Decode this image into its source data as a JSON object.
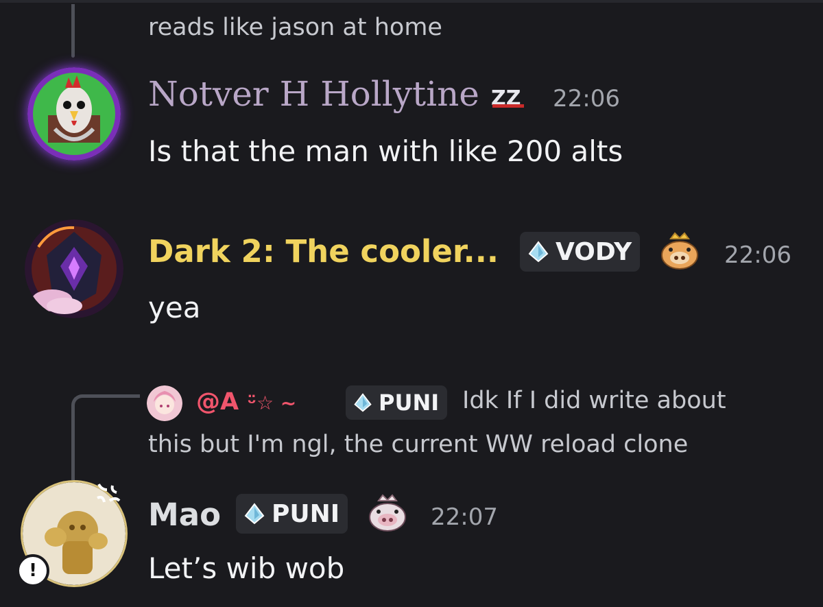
{
  "previous_message": {
    "text": "reads like jason at home"
  },
  "messages": [
    {
      "author": "Notver H Hollytine",
      "author_color": "#b9a7c7",
      "badge_icon": "zz-badge-icon",
      "badge_text": "ZZ",
      "time": "22:06",
      "text": "Is that the man with like 200 alts",
      "avatar": "rooster-avatar"
    },
    {
      "author": "Dark 2: The cooler...",
      "author_color": "#f0d35e",
      "tag": {
        "icon": "water-drop-icon",
        "label": "VODY"
      },
      "badge_icon": "crowned-boar-icon",
      "time": "22:06",
      "text": "yea",
      "avatar": "dark-crystal-avatar"
    },
    {
      "reply": {
        "author": "@A",
        "author_suffix": "ᵕ̈☆ ~",
        "author_color": "#f0556c",
        "tag": {
          "icon": "water-drop-icon",
          "label": "PUNI"
        },
        "line1": "Idk If I did write about",
        "line2": "this but I'm ngl, the current WW reload clone"
      },
      "author": "Mao",
      "author_color": "#dcdee1",
      "tag": {
        "icon": "water-drop-icon",
        "label": "PUNI"
      },
      "badge_icon": "crowned-boar-icon",
      "time": "22:07",
      "text": "Let’s wib wob",
      "avatar": "golden-figure-avatar",
      "status": {
        "icon": "alert-icon",
        "text": "!"
      }
    }
  ]
}
